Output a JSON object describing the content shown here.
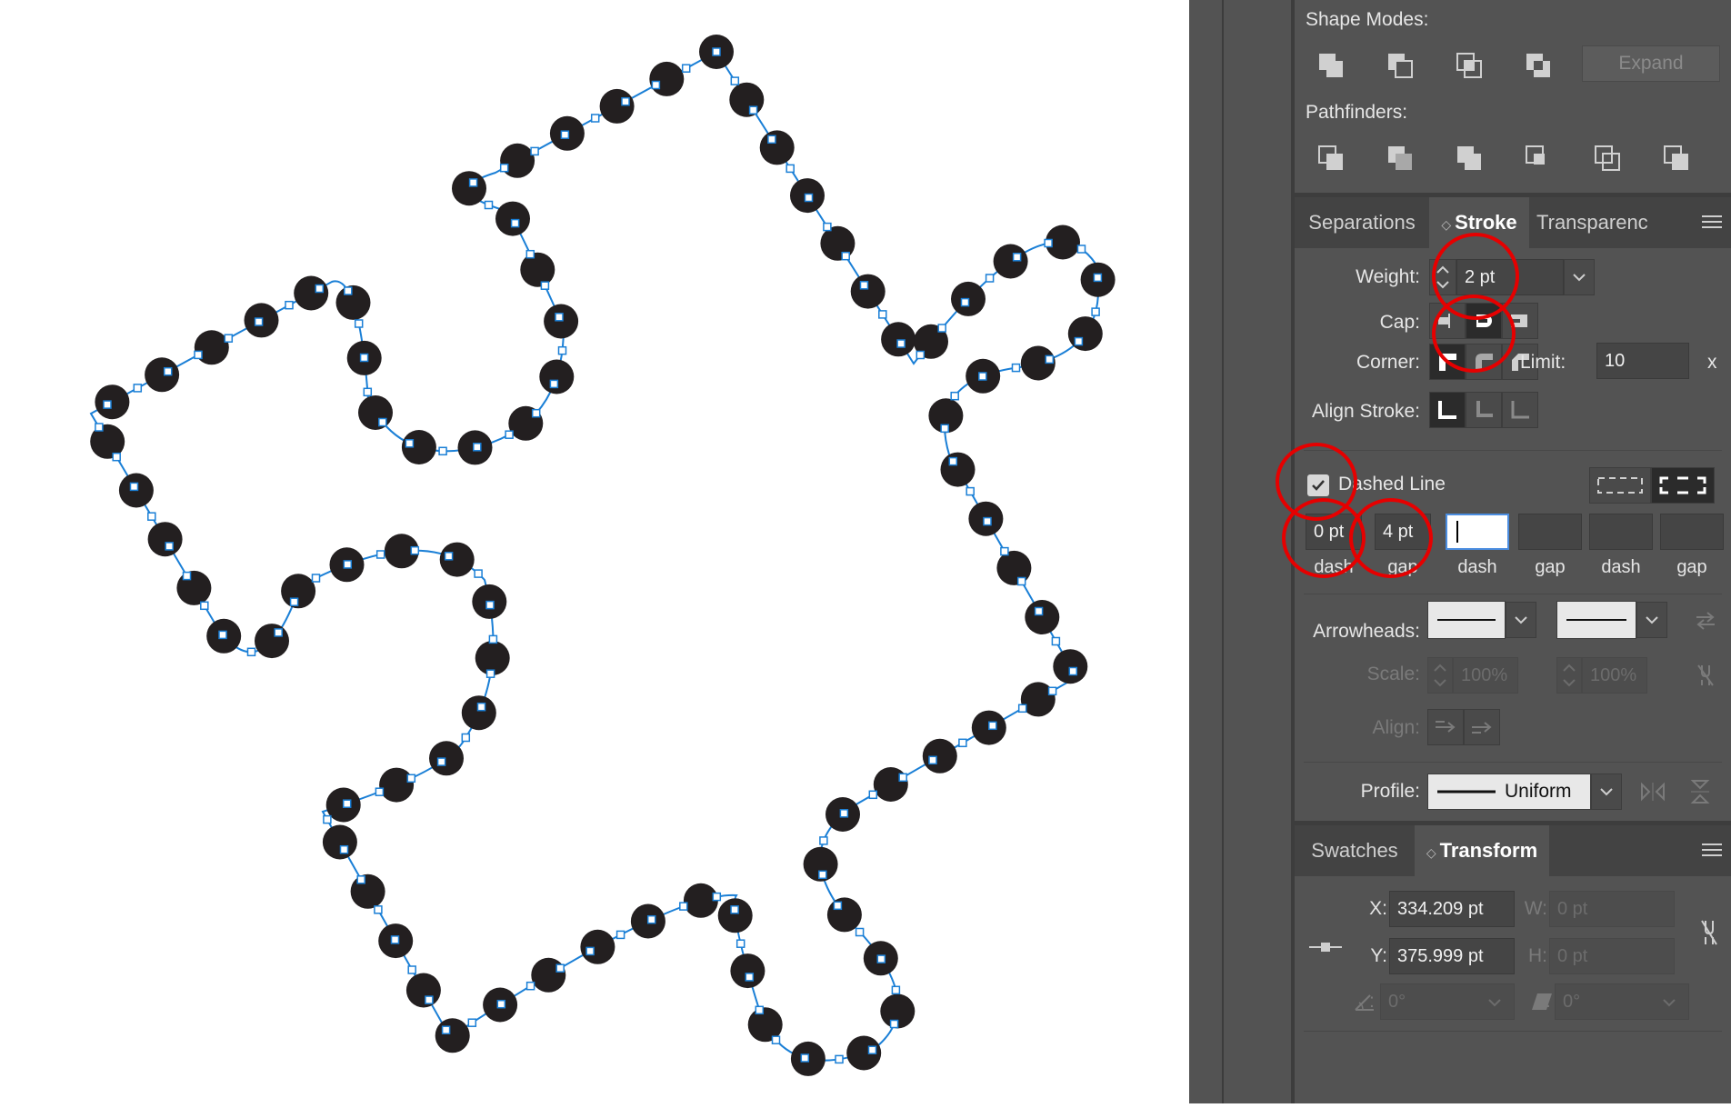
{
  "colors": {
    "path": "#1a7fd6",
    "dot": "#231f20",
    "highlight": "#e60000",
    "panel_bg": "#535353"
  },
  "pathfinder": {
    "shape_modes_label": "Shape Modes:",
    "pathfinders_label": "Pathfinders:",
    "expand_label": "Expand",
    "shape_mode_icons": [
      "unite-icon",
      "minus-front-icon",
      "intersect-icon",
      "exclude-icon"
    ],
    "pathfinder_icons": [
      "divide-icon",
      "trim-icon",
      "merge-icon",
      "crop-icon",
      "outline-icon",
      "minus-back-icon"
    ]
  },
  "stroke_tabs": {
    "separations": "Separations",
    "stroke": "Stroke",
    "transparency": "Transparenc"
  },
  "stroke": {
    "weight_label": "Weight:",
    "weight_value": "2 pt",
    "cap_label": "Cap:",
    "corner_label": "Corner:",
    "limit_label": "Limit:",
    "limit_value": "10",
    "limit_unit": "x",
    "align_label": "Align Stroke:",
    "dashed_label": "Dashed Line",
    "dashed_checked": true,
    "dash_fields": [
      {
        "value": "0 pt",
        "label": "dash"
      },
      {
        "value": "4 pt",
        "label": "gap"
      },
      {
        "value": "",
        "label": "dash"
      },
      {
        "value": "",
        "label": "gap"
      },
      {
        "value": "",
        "label": "dash"
      },
      {
        "value": "",
        "label": "gap"
      }
    ],
    "arrowheads_label": "Arrowheads:",
    "scale_label": "Scale:",
    "scale_start": "100%",
    "scale_end": "100%",
    "align_arrow_label": "Align:",
    "profile_label": "Profile:",
    "profile_value": "Uniform"
  },
  "transform_tabs": {
    "swatches": "Swatches",
    "transform": "Transform"
  },
  "transform": {
    "x_label": "X:",
    "x_value": "334.209 pt",
    "y_label": "Y:",
    "y_value": "375.999 pt",
    "w_label": "W:",
    "w_value": "0 pt",
    "h_label": "H:",
    "h_value": "0 pt",
    "rotate_value": "0°",
    "shear_value": "0°"
  }
}
